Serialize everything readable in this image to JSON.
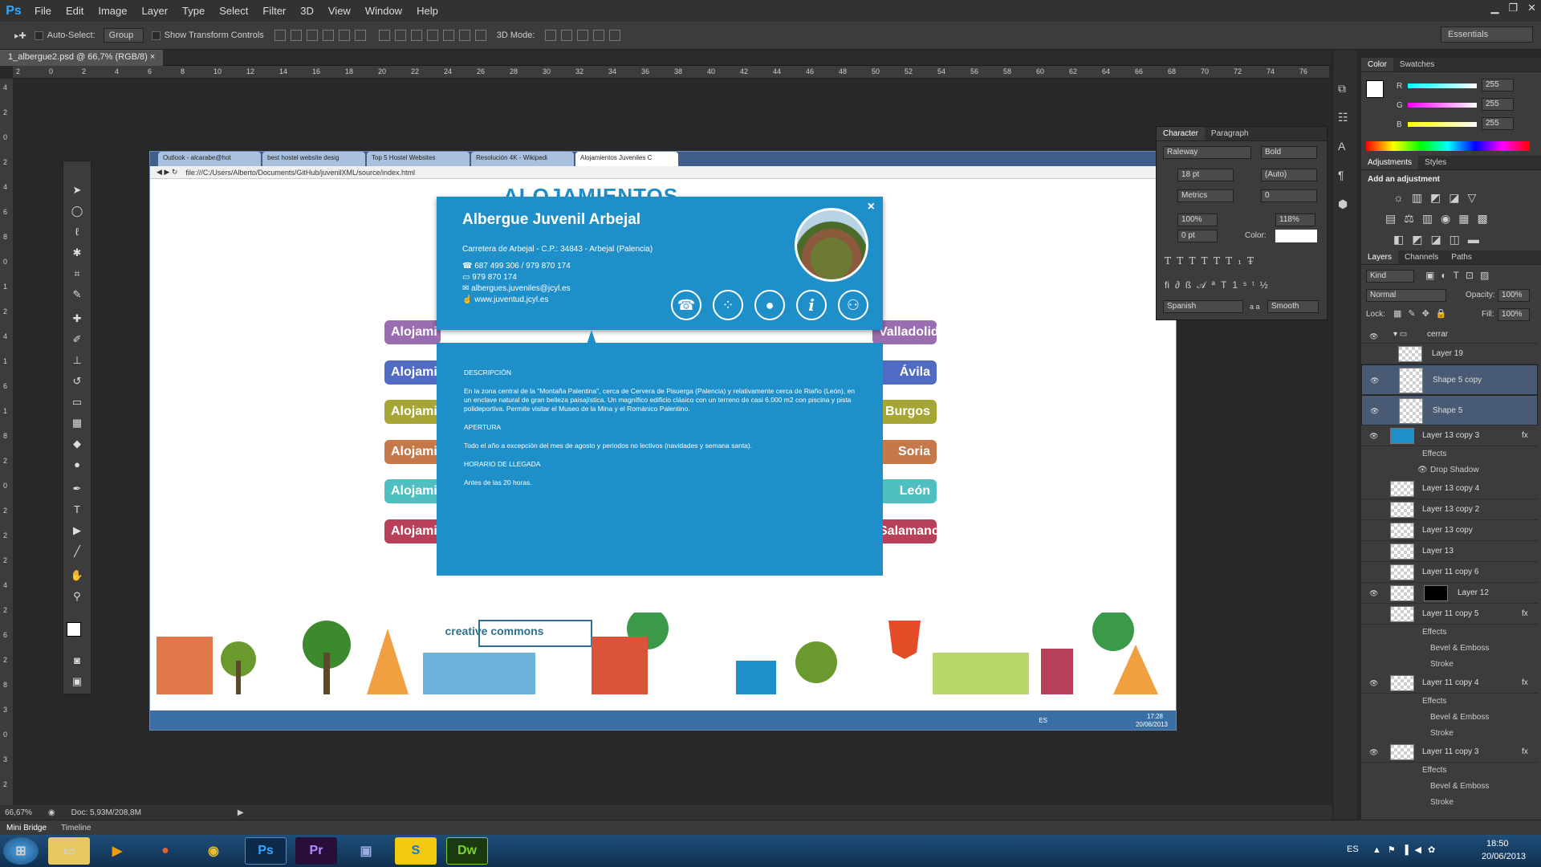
{
  "app": {
    "logo": "Ps",
    "menu": [
      "File",
      "Edit",
      "Image",
      "Layer",
      "Type",
      "Select",
      "Filter",
      "3D",
      "View",
      "Window",
      "Help"
    ],
    "workspace": "Essentials"
  },
  "options": {
    "auto_select": "Auto-Select:",
    "group": "Group",
    "transform": "Show Transform Controls",
    "mode3d": "3D Mode:"
  },
  "document": {
    "tab": "1_albergue2.psd @ 66,7% (RGB/8)"
  },
  "ruler": {
    "h": [
      "2",
      "0",
      "2",
      "4",
      "6",
      "8",
      "10",
      "12",
      "14",
      "16",
      "18",
      "20",
      "22",
      "24",
      "26",
      "28",
      "30",
      "32",
      "34",
      "36",
      "38",
      "40",
      "42",
      "44",
      "46",
      "48",
      "50",
      "52",
      "54",
      "56",
      "58",
      "60",
      "62",
      "64",
      "66",
      "68",
      "70",
      "72",
      "74",
      "76"
    ],
    "v": [
      "4",
      "2",
      "0",
      "2",
      "4",
      "6",
      "8",
      "0",
      "1",
      "2",
      "4",
      "1",
      "6",
      "1",
      "8",
      "2",
      "0",
      "2",
      "2",
      "2",
      "4",
      "2",
      "6",
      "2",
      "8",
      "3",
      "0",
      "3",
      "2"
    ]
  },
  "status": {
    "zoom": "66,67%",
    "doc": "Doc: 5,93M/208,8M"
  },
  "bottom_tabs": [
    "Mini Bridge",
    "Timeline"
  ],
  "browser": {
    "tabs": [
      "Outlook - alcarabe@hot",
      "best hostel website desig",
      "Top 5 Hostel Websites",
      "Resolución 4K - Wikipedi",
      "Alojamientos Juveniles C"
    ],
    "url": "file:///C:/Users/Alberto/Documents/GitHub/juvenilXML/source/index.html"
  },
  "site": {
    "logo_text": "ALOJAMIENTOS",
    "popup": {
      "title": "Albergue Juvenil Arbejal",
      "address": "Carretera de Arbejal - C.P.: 34843 - Arbejal (Palencia)",
      "phone": "687 499 306 / 979 870 174",
      "fax": "979 870 174",
      "email": "albergues.juveniles@jcyl.es",
      "web": "www.juventud.jcyl.es",
      "close": "×"
    },
    "detail": {
      "h1": "DESCRIPCIÓN",
      "p1": "En la zona central de la \"Montaña Palentina\", cerca de Cervera de Pisuerga (Palencia) y relativamente cerca de Riaño (León), en un enclave natural de gran belleza paisajística. Un magnífico edificio clásico con un terreno de casi 6.000 m2 con piscina y pista polideportiva. Permite visitar el Museo de la Mina y el Románico Palentino.",
      "h2": "APERTURA",
      "p2": "Todo el año a excepción del mes de agosto y periodos no lectivos (navidades y semana santa).",
      "h3": "HORARIO DE LLEGADA",
      "p3": "Antes de las 20 horas."
    },
    "left_pills": [
      "Alojami",
      "Alojami",
      "Alojami",
      "Alojami",
      "Alojami",
      "Alojami"
    ],
    "right_pills": [
      "Valladolid",
      "Ávila",
      "Burgos",
      "Soria",
      "León",
      "Salamanca"
    ],
    "pill_colors": [
      "#9a6db0",
      "#4f6bc4",
      "#a6a637",
      "#c5784a",
      "#4fbfc2",
      "#b8405a"
    ],
    "cc": "creative commons",
    "clock": "17:28",
    "date": "20/06/2013",
    "lang": "ES"
  },
  "character": {
    "tabs": [
      "Character",
      "Paragraph"
    ],
    "font": "Raleway",
    "style": "Bold",
    "size": "18 pt",
    "leading": "(Auto)",
    "kerning": "Metrics",
    "tracking": "0",
    "vscale": "100%",
    "hscale": "118%",
    "baseline": "0 pt",
    "color_label": "Color:",
    "lang": "Spanish",
    "aa": "Smooth",
    "aa_label": "a a"
  },
  "color": {
    "tabs": [
      "Color",
      "Swatches"
    ],
    "r": "255",
    "g": "255",
    "b": "255",
    "rl": "R",
    "gl": "G",
    "bl": "B"
  },
  "adjust": {
    "tabs": [
      "Adjustments",
      "Styles"
    ],
    "title": "Add an adjustment"
  },
  "layers": {
    "tabs": [
      "Layers",
      "Channels",
      "Paths"
    ],
    "kind": "Kind",
    "blend": "Normal",
    "opacity_label": "Opacity:",
    "opacity": "100%",
    "lock": "Lock:",
    "fill_label": "Fill:",
    "fill": "100%",
    "items": [
      "cerrar",
      "Layer 19",
      "Shape 5 copy",
      "Shape 5",
      "Layer 13 copy 3",
      "Effects",
      "Drop Shadow",
      "Layer 13 copy 4",
      "Layer 13 copy 2",
      "Layer 13 copy",
      "Layer 13",
      "Layer 11 copy 6",
      "Layer 12",
      "Layer 11 copy 5",
      "Effects",
      "Bevel & Emboss",
      "Stroke",
      "Layer 11 copy 4",
      "Effects",
      "Bevel & Emboss",
      "Stroke",
      "Layer 11 copy 3",
      "Effects",
      "Bevel & Emboss",
      "Stroke"
    ]
  },
  "taskbar": {
    "time": "18:50",
    "date": "20/06/2013",
    "lang": "ES",
    "apps": [
      "Ps",
      "Pr",
      "Dw"
    ]
  }
}
